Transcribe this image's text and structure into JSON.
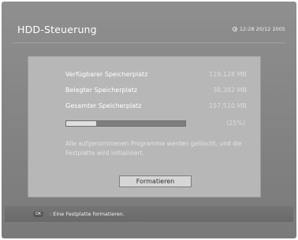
{
  "header": {
    "title": "HDD-Steuerung",
    "datetime": "12:28 20/12 2005",
    "clock_icon": "clock-icon"
  },
  "storage": {
    "rows": [
      {
        "label": "Verfügbarer Speicherplatz",
        "value": "119,128 MB"
      },
      {
        "label": "Belegter Speicherplatz",
        "value": "38,382 MB"
      },
      {
        "label": "Gesamter Speicherplatz",
        "value": "157,510 MB"
      }
    ],
    "usage_fraction": 0.25,
    "usage_label": "(25%)"
  },
  "message": "Alle aufgenommenen Programme werden gelöscht, und die Festplatte wird initialisiert.",
  "format_button": {
    "label": "Formatieren"
  },
  "footer": {
    "key_label": "OK",
    "hint": ": Eine Festplatte formatieren."
  },
  "colors": {
    "screen_bg": "#8a8a8a",
    "panel_bg": "#b7b7b7",
    "progress_fill": "#e0e0e0",
    "progress_track": "#7e7e7e"
  }
}
